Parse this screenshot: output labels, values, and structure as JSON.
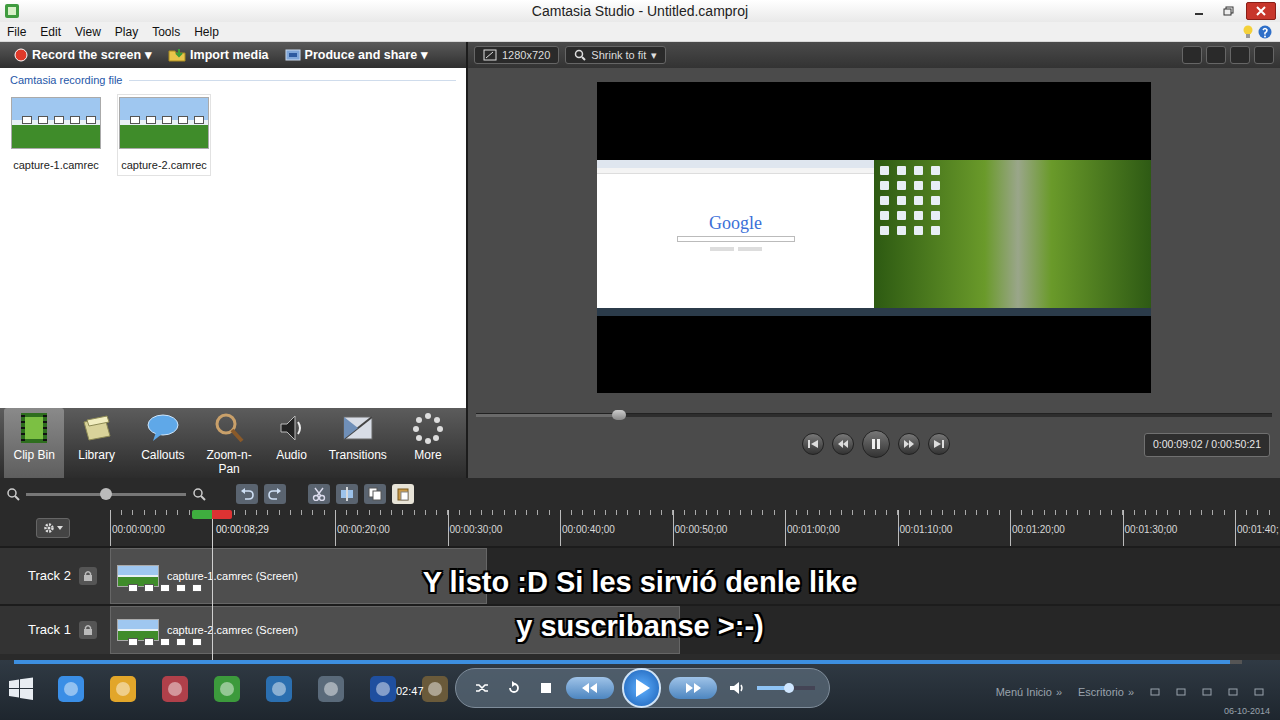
{
  "window": {
    "title": "Camtasia Studio - Untitled.camproj"
  },
  "menu": [
    {
      "label": "File"
    },
    {
      "label": "Edit"
    },
    {
      "label": "View"
    },
    {
      "label": "Play"
    },
    {
      "label": "Tools"
    },
    {
      "label": "Help"
    }
  ],
  "toolbar": [
    {
      "label": "Record the screen",
      "arrow": "▾",
      "kind": "record"
    },
    {
      "label": "Import media",
      "kind": "import"
    },
    {
      "label": "Produce and share",
      "arrow": "▾",
      "kind": "produce"
    }
  ],
  "clip_bin": {
    "heading": "Camtasia recording file",
    "clips": [
      {
        "name": "capture-1.camrec",
        "selected": false
      },
      {
        "name": "capture-2.camrec",
        "selected": true
      }
    ]
  },
  "tabs": [
    {
      "label": "Clip Bin",
      "selected": true,
      "kind": "clipbin"
    },
    {
      "label": "Library",
      "selected": false,
      "kind": "library"
    },
    {
      "label": "Callouts",
      "selected": false,
      "kind": "callouts"
    },
    {
      "label": "Zoom-n-Pan",
      "selected": false,
      "kind": "zoom"
    },
    {
      "label": "Audio",
      "selected": false,
      "kind": "audio"
    },
    {
      "label": "Transitions",
      "selected": false,
      "kind": "transitions"
    },
    {
      "label": "More",
      "selected": false,
      "kind": "more"
    }
  ],
  "preview": {
    "size": "1280x720",
    "zoom": "Shrink to fit",
    "zoom_arrow": "▾",
    "screen": {
      "logo": "Google"
    },
    "scrubber": {
      "level": 0.18
    },
    "playing": true,
    "time": "0:00:09:02 / 0:00:50:21"
  },
  "timeline": {
    "zoom": {
      "level": 0.5
    },
    "ruler": [
      "00:00:00;00",
      "00:00:20;00",
      "00:00:30;00",
      "00:00:40;00",
      "00:00:50;00",
      "00:01:00;00",
      "00:01:10;00",
      "00:01:20;00",
      "00:01:30;00",
      "00:01:40;"
    ],
    "playhead": "00:00:08;29",
    "tracks": [
      {
        "name": "Track 2",
        "clip": "capture-1.camrec (Screen)",
        "level": 0.322
      },
      {
        "name": "Track 1",
        "clip": "capture-2.camrec (Screen)",
        "level": 0.487
      }
    ]
  },
  "subtitle": {
    "lines": [
      "Y listo :D Si les sirvió denle like",
      "y suscribanse >:-)"
    ]
  },
  "player": {
    "time": "02:47",
    "level": 0.99,
    "volume": 0.55,
    "playing": false
  },
  "taskbar": {
    "links": [
      {
        "label": "Menú Inicio",
        "arrow": "»"
      },
      {
        "label": "Escritorio",
        "arrow": "»"
      }
    ],
    "date": "06-10-2014"
  }
}
